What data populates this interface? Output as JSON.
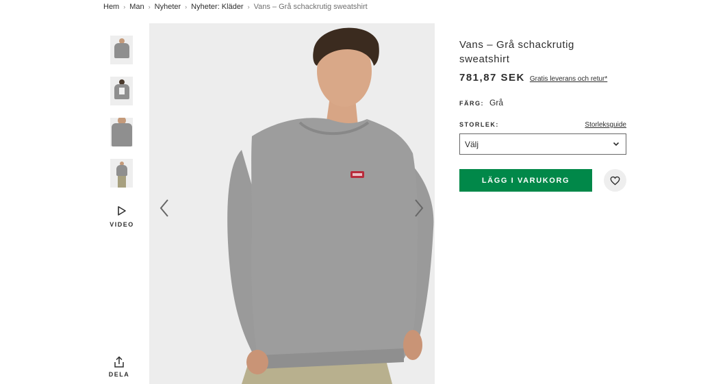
{
  "breadcrumb": [
    "Hem",
    "Man",
    "Nyheter",
    "Nyheter: Kläder",
    "Vans – Grå schackrutig sweatshirt"
  ],
  "gallery": {
    "thumbnails": [
      "thumb-front",
      "thumb-back",
      "thumb-closeup",
      "thumb-full"
    ],
    "video_label": "VIDEO",
    "share_label": "DELA"
  },
  "product": {
    "title": "Vans – Grå schackrutig sweatshirt",
    "price": "781,87 SEK",
    "delivery_link": "Gratis leverans och retur*",
    "color_label": "FÄRG:",
    "color_value": "Grå",
    "size_label": "STORLEK:",
    "size_guide": "Storleksguide",
    "size_select": "Välj",
    "add_to_cart": "LÄGG I VARUKORG"
  },
  "colors": {
    "accent_green": "#018849",
    "text": "#2d2d2d",
    "sweatshirt_gray": "#9a9a9a"
  },
  "icons": [
    "play-icon",
    "share-icon",
    "chevron-left-icon",
    "chevron-right-icon",
    "chevron-down-icon",
    "heart-icon"
  ]
}
